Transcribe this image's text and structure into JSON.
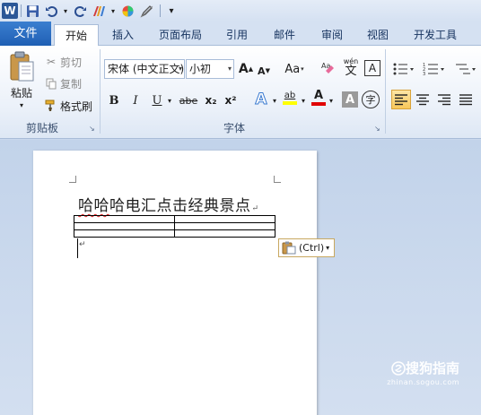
{
  "quick_access": {
    "more_label": "▾"
  },
  "tabs": {
    "file": "文件",
    "items": [
      "开始",
      "插入",
      "页面布局",
      "引用",
      "邮件",
      "审阅",
      "视图",
      "开发工具"
    ]
  },
  "clipboard": {
    "paste": "粘贴",
    "cut": "剪切",
    "copy": "复制",
    "format_painter": "格式刷",
    "group_label": "剪贴板"
  },
  "font": {
    "font_name": "宋体 (中文正文)",
    "font_size": "小初",
    "group_label": "字体",
    "bold": "B",
    "italic": "I",
    "underline": "U",
    "strike": "abe",
    "subscript": "x₂",
    "superscript": "x²",
    "change_case": "Aa",
    "grow": "A",
    "shrink": "A",
    "phonetic": "wén",
    "phonetic_base": "文",
    "char_border": "A",
    "text_effect": "A",
    "highlight": "ab",
    "font_color": "A",
    "char_shading": "A",
    "enclose": "字"
  },
  "document": {
    "title": "哈哈哈电汇点击经典景点",
    "title_underlined_part": "哈哈",
    "title_rest": "哈电汇点击经典景点",
    "paste_options_label": "(Ctrl)"
  },
  "watermark": {
    "main": "搜狗指南",
    "sub": "zhinan.sogou.com"
  },
  "colors": {
    "file_tab": "#2a6bc4",
    "font_color_bar": "#e00000",
    "highlight_bar": "#ffff00"
  }
}
